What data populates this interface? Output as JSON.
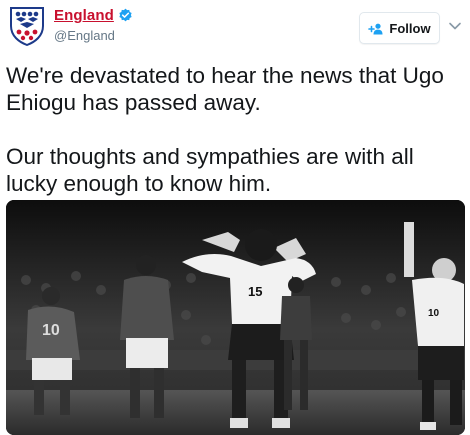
{
  "account": {
    "display_name": "England",
    "handle": "@England",
    "verified": true,
    "brand_color": "#c8102e"
  },
  "actions": {
    "follow_label": "Follow",
    "follow_icon": "add-user-icon",
    "more_icon": "chevron-down-icon"
  },
  "tweet": {
    "paragraph_1": "We're devastated to hear the news that Ugo Ehiogu has passed away.",
    "paragraph_2": "Our thoughts and sympathies are with all lucky enough to know him."
  },
  "photo": {
    "jersey_numbers": [
      "10",
      "15",
      "10"
    ],
    "style": "black-and-white"
  }
}
